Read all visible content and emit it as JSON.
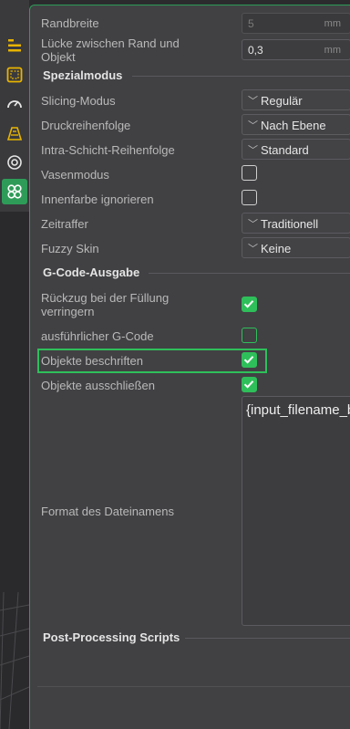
{
  "sidebar": {
    "icons": [
      {
        "name": "quality-icon",
        "active": false
      },
      {
        "name": "strength-icon",
        "active": false
      },
      {
        "name": "speed-icon",
        "active": false
      },
      {
        "name": "support-icon",
        "active": false
      },
      {
        "name": "multimaterial-icon",
        "active": false
      },
      {
        "name": "others-icon",
        "active": true
      }
    ]
  },
  "settings": {
    "randbreite": {
      "label": "Randbreite",
      "value": "5",
      "unit": "mm"
    },
    "luecke": {
      "label": "Lücke zwischen Rand und Objekt",
      "value": "0,3",
      "unit": "mm"
    },
    "spezialmodus": {
      "title": "Spezialmodus"
    },
    "slicing_modus": {
      "label": "Slicing-Modus",
      "value": "Regulär"
    },
    "druckreihenfolge": {
      "label": "Druckreihenfolge",
      "value": "Nach Ebene"
    },
    "intra_schicht": {
      "label": "Intra-Schicht-Reihenfolge",
      "value": "Standard"
    },
    "vasenmodus": {
      "label": "Vasenmodus",
      "checked": false
    },
    "innenfarbe": {
      "label": "Innenfarbe ignorieren",
      "checked": false
    },
    "zeitraffer": {
      "label": "Zeitraffer",
      "value": "Traditionell"
    },
    "fuzzy_skin": {
      "label": "Fuzzy Skin",
      "value": "Keine"
    },
    "gcode_ausgabe": {
      "title": "G-Code-Ausgabe"
    },
    "rueckzug": {
      "label": "Rückzug bei der Füllung verringern",
      "checked": true
    },
    "ausfuehrlicher": {
      "label": "ausführlicher G-Code",
      "checked": false
    },
    "objekte_beschriften": {
      "label": "Objekte beschriften",
      "checked": true
    },
    "objekte_ausschliessen": {
      "label": "Objekte ausschließen",
      "checked": true
    },
    "dateiname": {
      "label": "Format des Dateinamens",
      "value": "{input_filename_b"
    },
    "post_processing": {
      "title": "Post-Processing Scripts"
    }
  },
  "colors": {
    "accent": "#2fbf5a",
    "panel": "#414144",
    "background": "#2b2b2e"
  }
}
